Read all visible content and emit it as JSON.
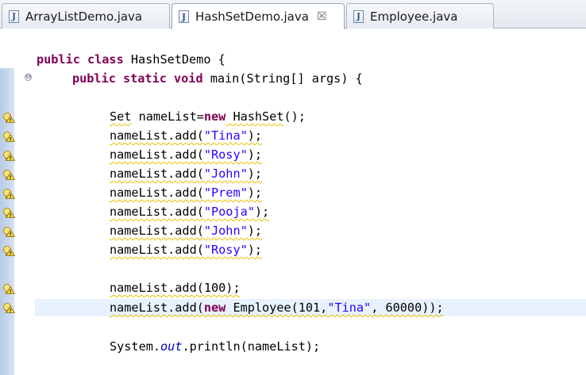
{
  "tabs": [
    {
      "label": "ArrayListDemo.java",
      "active": false
    },
    {
      "label": "HashSetDemo.java",
      "active": true,
      "close": "☒"
    },
    {
      "label": "Employee.java",
      "active": false
    }
  ],
  "tab_icon_letter": "J",
  "fold_symbol": "⊖",
  "code": {
    "class_decl": {
      "kw": "public class",
      "rest": " HashSetDemo {"
    },
    "main_decl": {
      "kw1": "public static void",
      "rest": " main(String[] args) {"
    },
    "set_line": {
      "type": "Set",
      "mid": " nameList=",
      "kw": "new",
      "ctor": " HashSet",
      "end": "();"
    },
    "adds": [
      {
        "pre": "nameList.add(",
        "arg": "\"Tina\"",
        "post": ");"
      },
      {
        "pre": "nameList.add(",
        "arg": "\"Rosy\"",
        "post": ");"
      },
      {
        "pre": "nameList.add(",
        "arg": "\"John\"",
        "post": ");"
      },
      {
        "pre": "nameList.add(",
        "arg": "\"Prem\"",
        "post": ");"
      },
      {
        "pre": "nameList.add(",
        "arg": "\"Pooja\"",
        "post": ");"
      },
      {
        "pre": "nameList.add(",
        "arg": "\"John\"",
        "post": ");"
      },
      {
        "pre": "nameList.add(",
        "arg": "\"Rosy\"",
        "post": ");"
      }
    ],
    "add_number": "nameList.add(100);",
    "add_employee": {
      "pre": "nameList.add(",
      "kw": "new",
      "mid": " Employee(101,",
      "str": "\"Tina\"",
      "post": ", 60000));"
    },
    "println": {
      "pre": "System.",
      "field": "out",
      "post": ".println(nameList);"
    }
  },
  "colors": {
    "keyword": "#7f0055",
    "string": "#2a00ff",
    "field": "#0000c0",
    "current_line": "#e8f2fe",
    "ruler_blue": "#b6cbe6"
  }
}
